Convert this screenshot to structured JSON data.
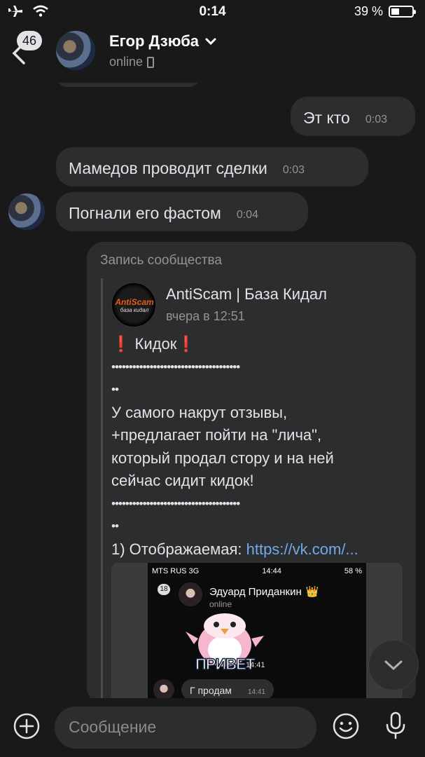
{
  "status_bar": {
    "time": "0:14",
    "battery": "39 %",
    "battery_level": 0.39
  },
  "header": {
    "back_badge": "46",
    "name": "Егор Дзюба",
    "status": "online"
  },
  "messages": [
    {
      "side": "out",
      "text": "Эт кто",
      "time": "0:03"
    },
    {
      "side": "in",
      "text": "Мамедов проводит сделки",
      "time": "0:03"
    },
    {
      "side": "in",
      "text": "Погнали его фастом",
      "time": "0:04"
    }
  ],
  "repost": {
    "label": "Запись сообщества",
    "logo_text": "AntiScam",
    "logo_subtext": "база кидал",
    "source_name": "AntiScam | База Кидал",
    "source_date": "вчера в 12:51",
    "title": "Кидок",
    "dots": "•••••••••••••••••••••••••••••••••••••",
    "dots_tail": "••",
    "body": "У самого накрут отзывы,\n+предлагает пойти на \"лича\",\nкоторый продал стору и на ней\nсейчас сидит кидок!",
    "item_prefix": "1) Отображаемая: ",
    "item_link": "https://vk.com/...",
    "screenshot": {
      "carrier": "MTS RUS  3G",
      "time": "14:44",
      "battery": "58 %",
      "back_badge": "18",
      "name": "Эдуард Приданкин",
      "crown": "👑",
      "status": "online",
      "sticker_word": "ПРИВЕТ",
      "sticker_time": "14:41",
      "message": "Г продам",
      "message_time": "14:41"
    }
  },
  "composer": {
    "placeholder": "Сообщение"
  },
  "colors": {
    "background": "#191919",
    "bubble": "#2c2d2e",
    "link": "#71aaeb",
    "secondary": "#939393",
    "alert": "#e64646"
  }
}
